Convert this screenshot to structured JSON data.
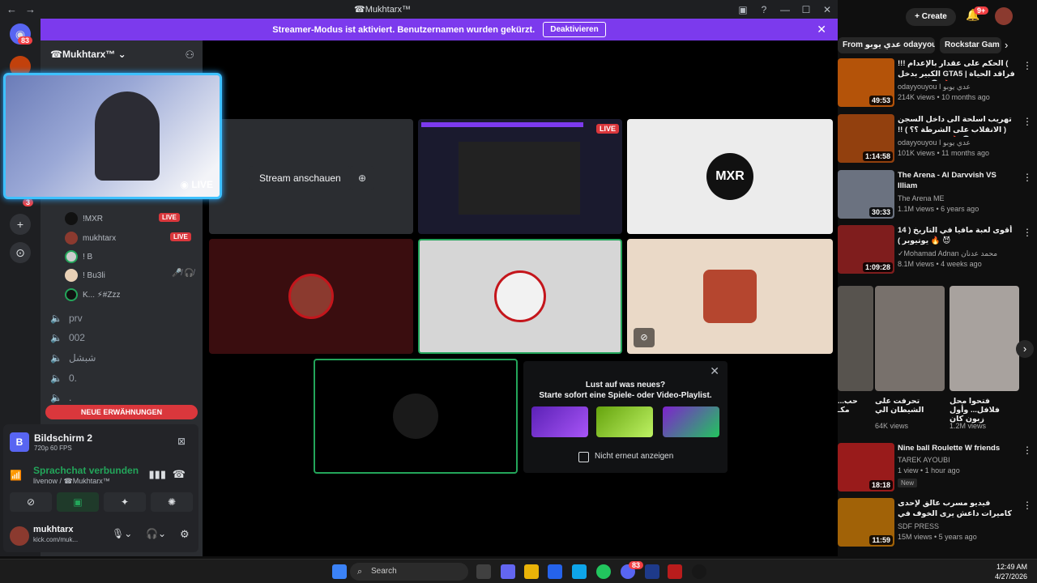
{
  "titlebar": {
    "title": "☎Mukhtarx™",
    "back": "←",
    "forward": "→"
  },
  "banner": {
    "text": "Streamer-Modus ist aktiviert. Benutzernamen wurden gekürzt.",
    "button": "Deaktivieren",
    "close": "✕"
  },
  "rail": {
    "badge": "83",
    "badge2": "3"
  },
  "sidebar": {
    "server_name": "☎Mukhtarx™ ⌄",
    "voice_users": [
      {
        "name": "!MXR",
        "live": "LIVE"
      },
      {
        "name": "mukhtarx",
        "live": "LIVE"
      },
      {
        "name": "! B",
        "live": ""
      },
      {
        "name": "! Bu3li",
        "live": ""
      },
      {
        "name": "K... ⚡#Zzz",
        "live": ""
      }
    ],
    "channels": [
      "prv",
      "002",
      "شبشل",
      "0.",
      "."
    ],
    "mentions": "NEUE ERWÄHNUNGEN"
  },
  "voicepanel": {
    "screen_title": "Bildschirm 2",
    "screen_sub": "720p 60 FPS",
    "screen_badge": "B",
    "connected": "Sprachchat verbunden",
    "connected_sub": "livenow / ☎Mukhtarx™",
    "username": "mukhtarx",
    "status": "kick.com/muk..."
  },
  "stage": {
    "stream_button": "Stream anschauen",
    "playlist_title": "Lust auf was neues?",
    "playlist_sub": "Starte sofort eine Spiele- oder Video-Playlist.",
    "dont_show": "Nicht erneut anzeigen",
    "live_badge": "LIVE",
    "mxr_label": "MXR"
  },
  "cam": {
    "live": "◉ LIVE"
  },
  "youtube": {
    "create": "+ Create",
    "notif_badge": "9+",
    "chips": [
      "From عدي يوبو odayyouyou I",
      "Rockstar Gam"
    ],
    "videos": [
      {
        "title": "!!! الحكم على عقدار بالإعدام ( الكبير بدخل GTA5 | فراقد الحياة الواقعية 💀 🔥 !! )",
        "channel": "odayyouyou I عدي يوبو",
        "meta": "214K views • 10 months ago",
        "duration": "49:53"
      },
      {
        "title": "تهريب اسلحة الى داخل السجن ( الانقلاب على الشرطة ؟؟ ) !! 💀 🔥 | فراقد الحياة",
        "channel": "odayyouyou I عدي يوبو",
        "meta": "101K views • 11 months ago",
        "duration": "1:14:58"
      },
      {
        "title": "The Arena - Al Darvvish VS Illiam",
        "channel": "The Arena ME",
        "meta": "1.1M views • 6 years ago",
        "duration": "30:33"
      },
      {
        "title": "أقوى لعبة مافيا في التاريخ ( 14 يوتيوبر ) 🔥 😈",
        "channel": "✓Mohamad Adnan محمد عدنان",
        "meta": "8.1M views • 4 weeks ago",
        "duration": "1:09:28"
      },
      {
        "title": "Nine ball Roulette W friends",
        "channel": "TAREK AYOUBI",
        "meta": "1 view • 1 hour ago",
        "duration": "18:18",
        "badge": "New"
      },
      {
        "title": "فيديو مسرب عالق لإحدى كاميرات داعش يرى الخوف في سفوفهم",
        "channel": "SDF PRESS",
        "meta": "15M views • 5 years ago",
        "duration": "11:59"
      }
    ],
    "shorts": [
      {
        "title": "حب... مكـ",
        "views": ""
      },
      {
        "title": "تحرفت على الشيطان الي",
        "views": "64K views"
      },
      {
        "title": "فتحوا محل فلافل... وأول زبون كان",
        "views": "1.2M views"
      }
    ]
  },
  "taskbar": {
    "search": "Search",
    "time": "12:49 AM",
    "date": "4/27/2026",
    "discord_badge": "83"
  }
}
